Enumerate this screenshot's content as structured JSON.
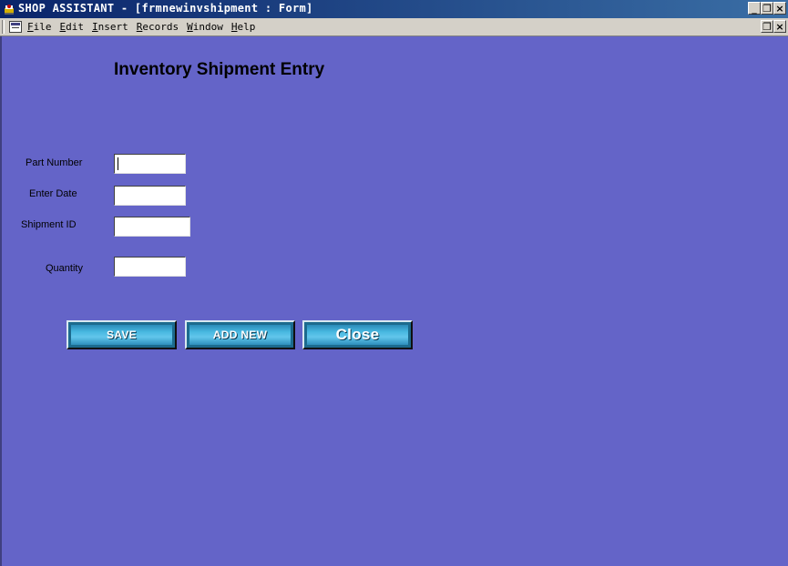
{
  "window": {
    "title": "SHOP ASSISTANT - [frmnewinvshipment : Form]",
    "controls": {
      "minimize": "_",
      "restore": "❐",
      "close": "×"
    }
  },
  "menubar": {
    "items": [
      "File",
      "Edit",
      "Insert",
      "Records",
      "Window",
      "Help"
    ]
  },
  "form": {
    "title": "Inventory Shipment Entry",
    "fields": [
      {
        "label": "Part Number",
        "value": ""
      },
      {
        "label": "Enter Date",
        "value": ""
      },
      {
        "label": "Shipment ID",
        "value": ""
      },
      {
        "label": "Quantity",
        "value": ""
      }
    ],
    "buttons": {
      "save": "SAVE",
      "add_new": "ADD NEW",
      "close": "Close"
    }
  },
  "colors": {
    "background": "#6464c8",
    "titlebar": "#0a246a",
    "button_face": "#48b8e0"
  },
  "icons": {
    "app": "shop-assistant-icon",
    "document": "form-document-icon"
  }
}
